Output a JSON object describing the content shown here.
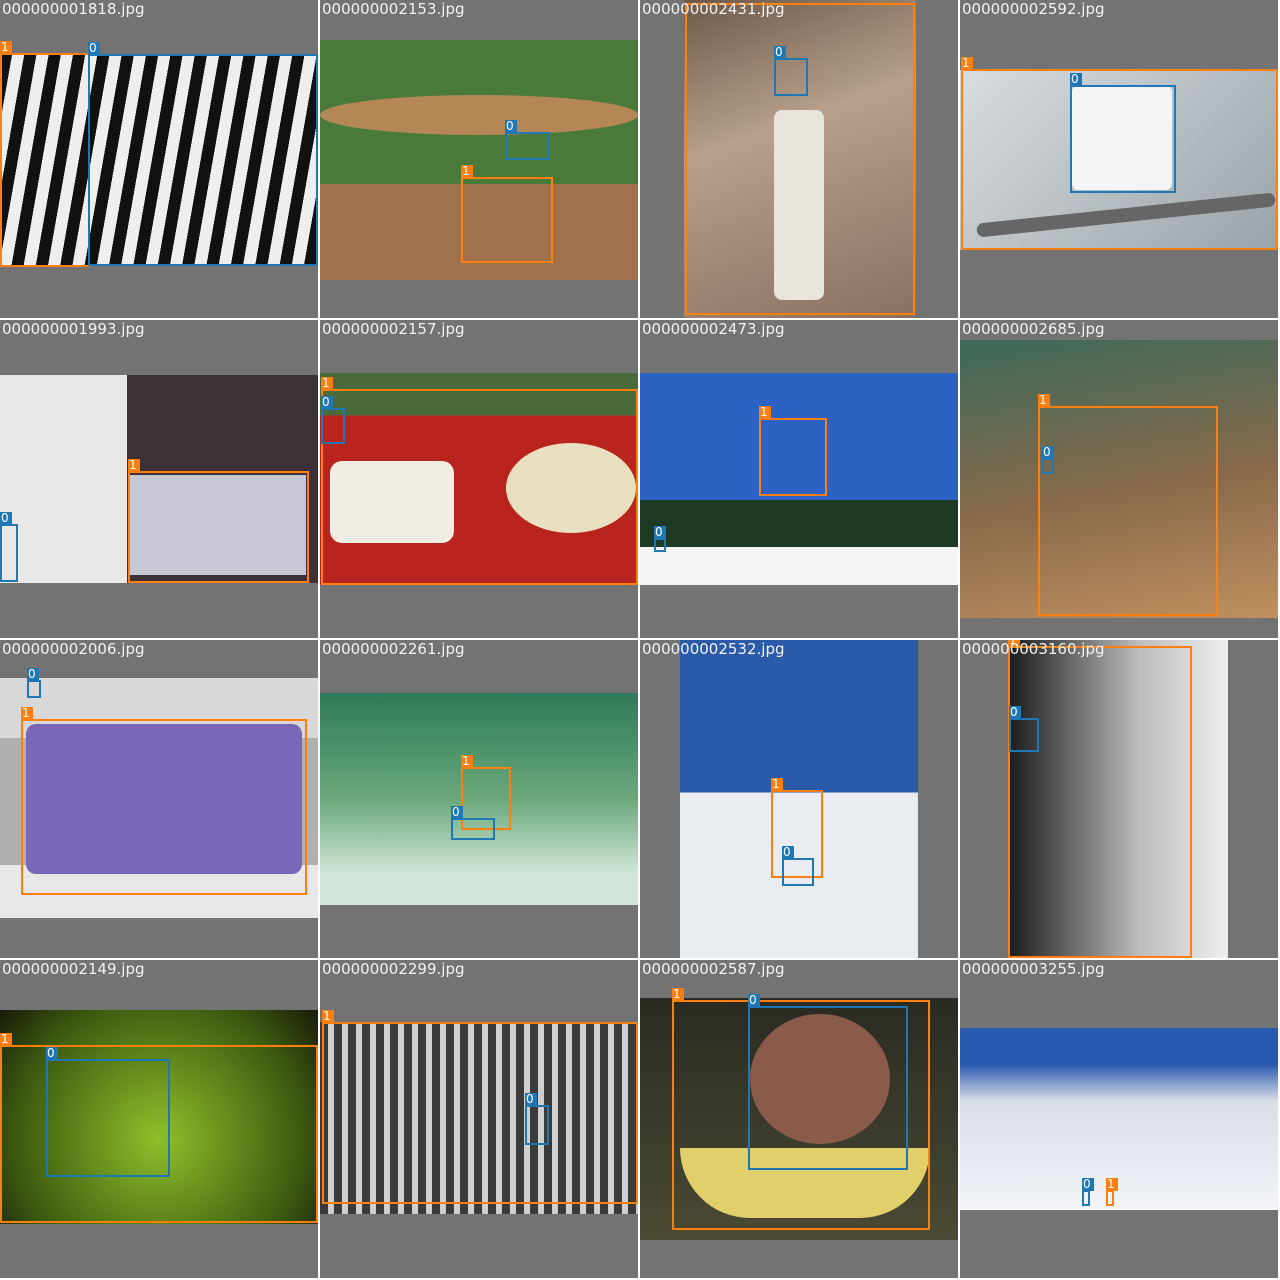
{
  "colors": {
    "class_0": "#1f77b4",
    "class_1": "#ff7f0e",
    "cell_bg": "#737373"
  },
  "tiles": [
    {
      "file": "000000001818.jpg",
      "boxes": [
        {
          "label": "1",
          "cls": 1
        },
        {
          "label": "0",
          "cls": 0
        }
      ]
    },
    {
      "file": "000000002153.jpg",
      "boxes": [
        {
          "label": "0",
          "cls": 0
        },
        {
          "label": "1",
          "cls": 1
        }
      ]
    },
    {
      "file": "000000002431.jpg",
      "boxes": [
        {
          "label": "0",
          "cls": 0
        }
      ]
    },
    {
      "file": "000000002592.jpg",
      "boxes": [
        {
          "label": "1",
          "cls": 1
        },
        {
          "label": "0",
          "cls": 0
        }
      ]
    },
    {
      "file": "000000001993.jpg",
      "boxes": [
        {
          "label": "0",
          "cls": 0
        },
        {
          "label": "1",
          "cls": 1
        }
      ]
    },
    {
      "file": "000000002157.jpg",
      "boxes": [
        {
          "label": "1",
          "cls": 1
        },
        {
          "label": "0",
          "cls": 0
        }
      ]
    },
    {
      "file": "000000002473.jpg",
      "boxes": [
        {
          "label": "1",
          "cls": 1
        },
        {
          "label": "0",
          "cls": 0
        }
      ]
    },
    {
      "file": "000000002685.jpg",
      "boxes": [
        {
          "label": "1",
          "cls": 1
        },
        {
          "label": "0",
          "cls": 0
        }
      ]
    },
    {
      "file": "000000002006.jpg",
      "boxes": [
        {
          "label": "0",
          "cls": 0
        },
        {
          "label": "1",
          "cls": 1
        }
      ]
    },
    {
      "file": "000000002261.jpg",
      "boxes": [
        {
          "label": "1",
          "cls": 1
        },
        {
          "label": "0",
          "cls": 0
        }
      ]
    },
    {
      "file": "000000002532.jpg",
      "boxes": [
        {
          "label": "1",
          "cls": 1
        },
        {
          "label": "0",
          "cls": 0
        }
      ]
    },
    {
      "file": "000000003160.jpg",
      "boxes": [
        {
          "label": "1",
          "cls": 1
        },
        {
          "label": "0",
          "cls": 0
        }
      ]
    },
    {
      "file": "000000002149.jpg",
      "boxes": [
        {
          "label": "1",
          "cls": 1
        },
        {
          "label": "0",
          "cls": 0
        }
      ]
    },
    {
      "file": "000000002299.jpg",
      "boxes": [
        {
          "label": "1",
          "cls": 1
        },
        {
          "label": "0",
          "cls": 0
        }
      ]
    },
    {
      "file": "000000002587.jpg",
      "boxes": [
        {
          "label": "1",
          "cls": 1
        },
        {
          "label": "0",
          "cls": 0
        }
      ]
    },
    {
      "file": "000000003255.jpg",
      "boxes": [
        {
          "label": "0",
          "cls": 0
        },
        {
          "label": "1",
          "cls": 1
        }
      ]
    }
  ]
}
